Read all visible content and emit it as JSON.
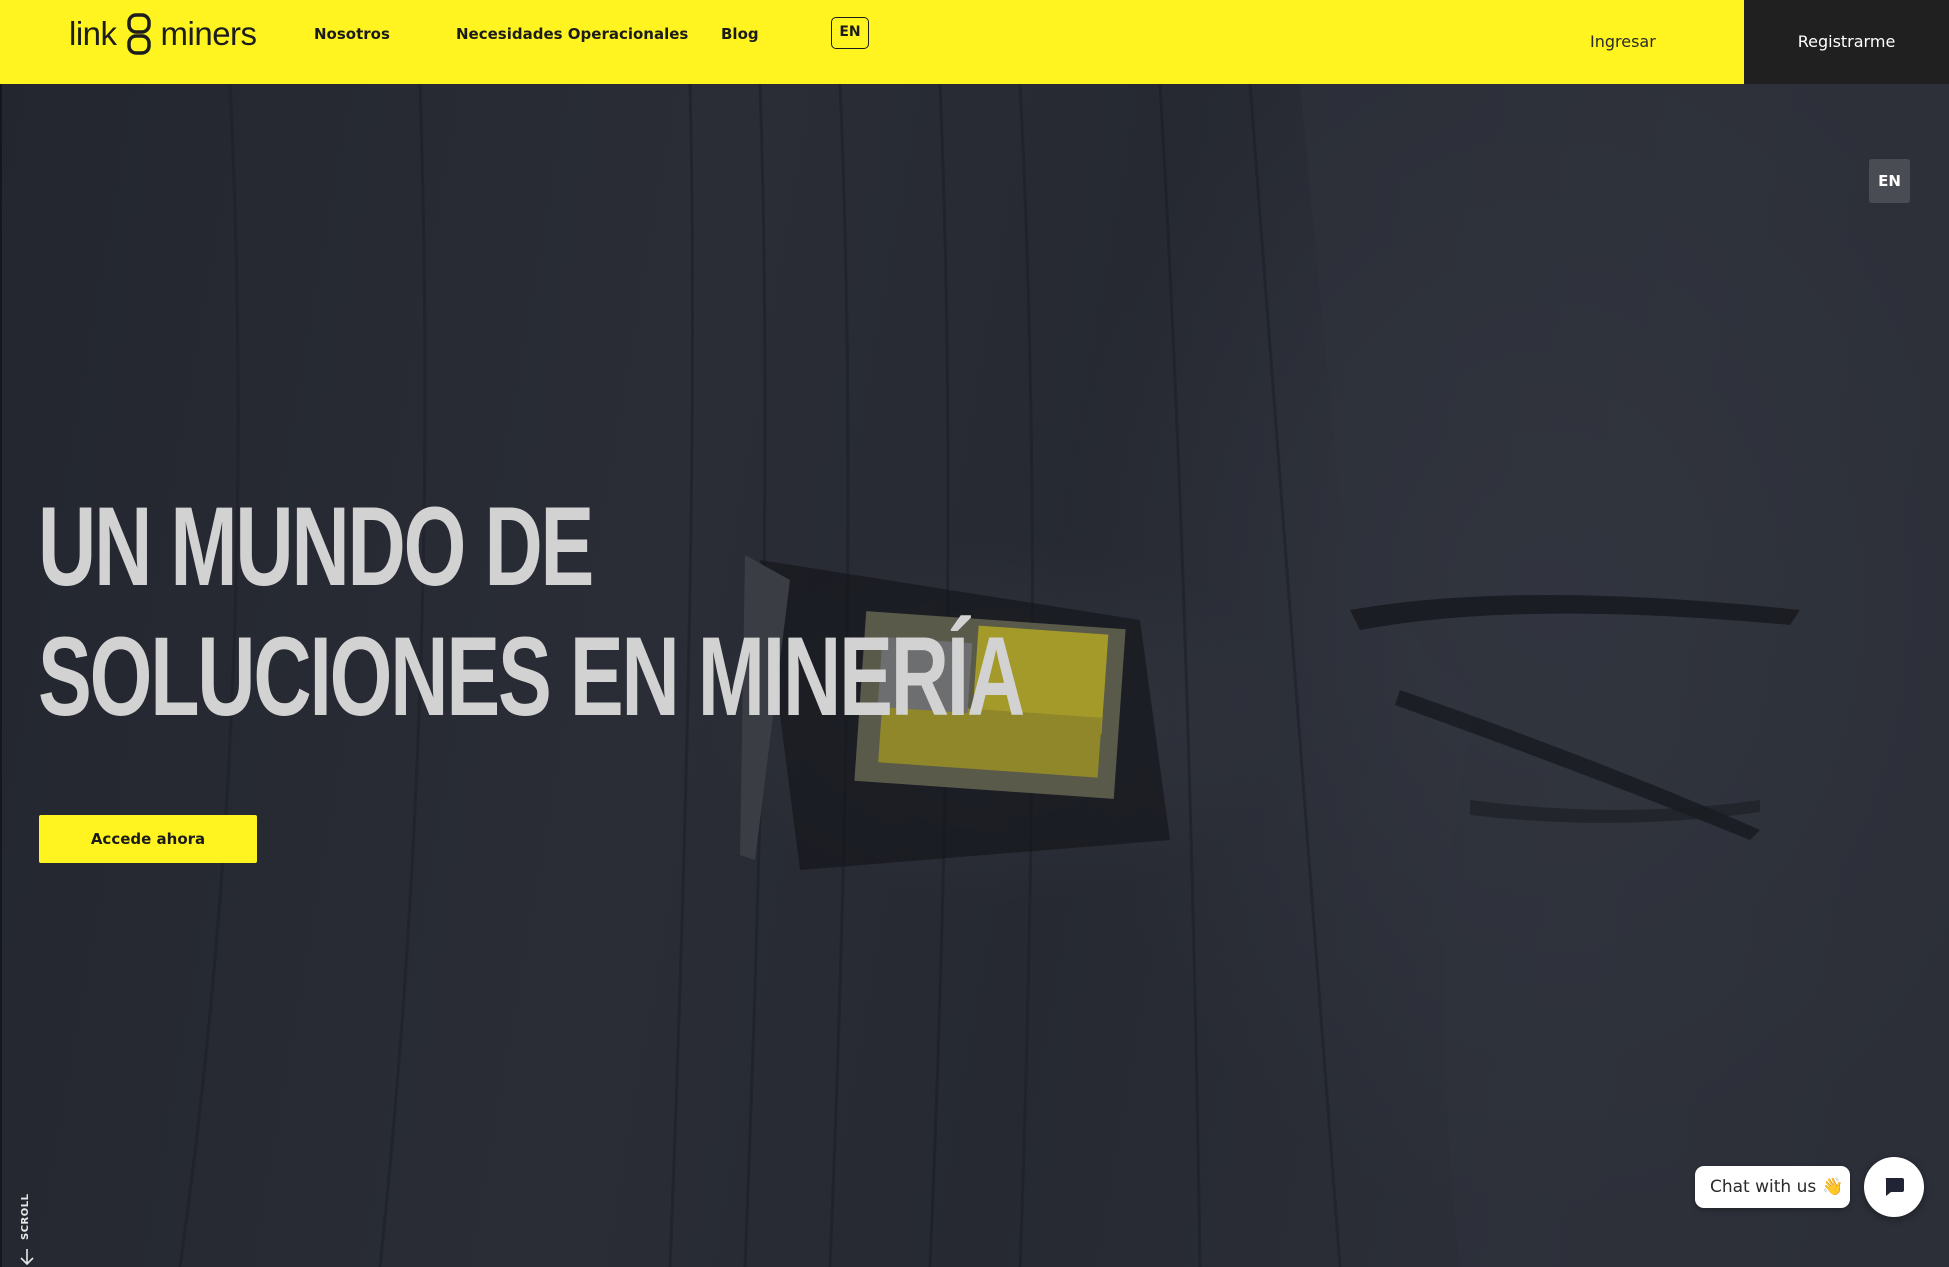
{
  "header": {
    "logo": {
      "left_word": "link",
      "right_word": "miners"
    },
    "nav": [
      {
        "label": "Nosotros"
      },
      {
        "label": "Necesidades Operacionales"
      },
      {
        "label": "Blog"
      }
    ],
    "language_chip": "EN",
    "login_label": "Ingresar",
    "register_label": "Registrarme",
    "colors": {
      "bar": "#fff41f",
      "register_bg": "#202020"
    }
  },
  "floating_language": "EN",
  "hero": {
    "headline_line1": "UN MUNDO DE",
    "headline_line2": "SOLUCIONES EN MINERÍA",
    "cta_label": "Accede ahora",
    "scroll_label": "SCROLL"
  },
  "chat": {
    "bubble_text": "Chat with us",
    "bubble_emoji_icon": "waving-hand-icon",
    "button_icon": "chat-message-icon"
  }
}
